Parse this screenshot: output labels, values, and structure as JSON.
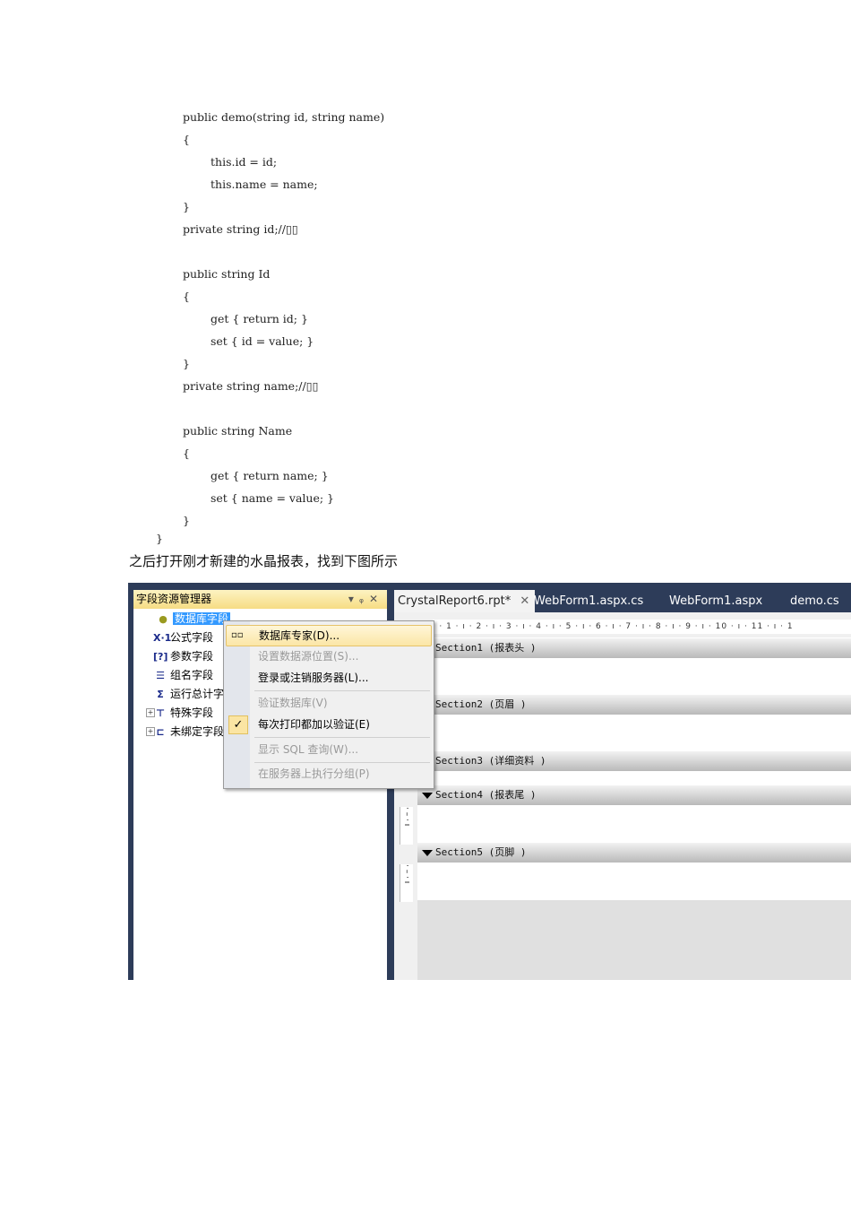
{
  "code": {
    "lines": [
      "public demo(string id, string name)",
      "{",
      "this.id = id;",
      "this.name = name;",
      "}",
      "private string id;//▯▯",
      "",
      "public string Id",
      "{",
      "get { return id; }",
      "set { id = value; }",
      "}",
      "private string name;//▯▯",
      "",
      "public string Name",
      "{",
      "get { return name; }",
      "set { name = value; }",
      "}",
      "}"
    ]
  },
  "paragraph": "之后打开刚才新建的水晶报表，找到下图所示",
  "screenshot": {
    "panel": {
      "title": "字段资源管理器",
      "buttons": [
        "▾",
        "📌",
        "✕"
      ],
      "tree": [
        "数据库字段",
        "公式字段",
        "参数字段",
        "组名字段",
        "运行总计字段",
        "特殊字段",
        "未绑定字段"
      ],
      "icons": [
        "●",
        "X·1",
        "[?]",
        "☰",
        "Σ",
        "⊤",
        "⊏"
      ]
    },
    "menu": {
      "items": [
        {
          "label": "数据库专家(D)...",
          "enabled": true
        },
        {
          "label": "设置数据源位置(S)...",
          "enabled": false
        },
        {
          "label": "登录或注销服务器(L)...",
          "enabled": true
        },
        {
          "label": "验证数据库(V)",
          "enabled": false
        },
        {
          "label": "每次打印都加以验证(E)",
          "enabled": true,
          "checked": true
        },
        {
          "label": "显示 SQL 查询(W)...",
          "enabled": false
        },
        {
          "label": "在服务器上执行分组(P)",
          "enabled": false
        }
      ]
    },
    "tabs": [
      "CrystalReport6.rpt*",
      "WebForm1.aspx.cs",
      "WebForm1.aspx",
      "demo.cs"
    ],
    "tab_close": "✕",
    "ruler": "ı · 1 · ı · 2 · ı · 3 · ı · 4 · ı · 5 · ı · 6 · ı · 7 · ı · 8 · ı · 9 · ı · 10 · ı · 11 · ı · 1",
    "vruler": "· – · ı",
    "sections": [
      "Section1 (报表头  )",
      "Section2 (页眉  )",
      "Section3 (详细资料  )",
      "Section4 (报表尾  )",
      "Section5 (页脚  )"
    ]
  }
}
